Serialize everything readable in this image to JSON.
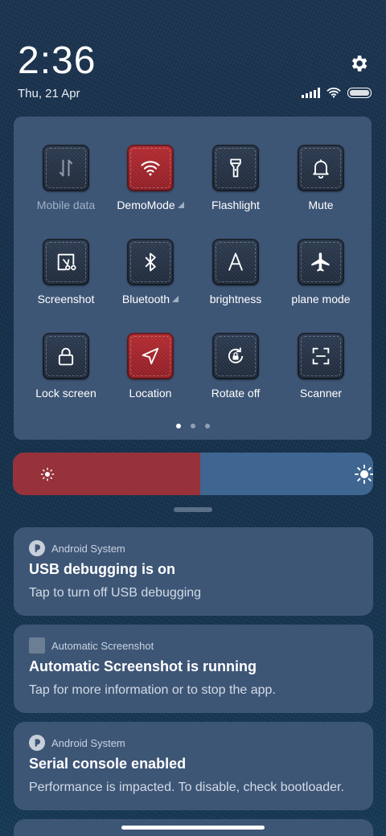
{
  "status": {
    "time": "2:36",
    "date": "Thu, 21 Apr",
    "icons": [
      "gear-icon",
      "signal-icon",
      "wifi-icon",
      "battery-icon"
    ]
  },
  "quick_settings": {
    "tiles": [
      {
        "label": "Mobile data",
        "icon": "mobile-data-icon",
        "active": false
      },
      {
        "label": "DemoMode",
        "icon": "wifi-icon",
        "active": true
      },
      {
        "label": "Flashlight",
        "icon": "flashlight-icon",
        "active": false
      },
      {
        "label": "Mute",
        "icon": "bell-icon",
        "active": false
      },
      {
        "label": "Screenshot",
        "icon": "screenshot-icon",
        "active": false
      },
      {
        "label": "Bluetooth",
        "icon": "bluetooth-icon",
        "active": false
      },
      {
        "label": "brightness",
        "icon": "brightness-auto-icon",
        "active": false
      },
      {
        "label": "plane mode",
        "icon": "airplane-icon",
        "active": false
      },
      {
        "label": "Lock screen",
        "icon": "lock-icon",
        "active": false
      },
      {
        "label": "Location",
        "icon": "location-icon",
        "active": true
      },
      {
        "label": "Rotate off",
        "icon": "rotate-lock-icon",
        "active": false
      },
      {
        "label": "Scanner",
        "icon": "scanner-icon",
        "active": false
      }
    ],
    "page": 1,
    "pages": 3
  },
  "brightness": {
    "level": 0.52
  },
  "notifications": [
    {
      "app": "Android System",
      "title": "USB debugging is on",
      "text": "Tap to turn off USB debugging"
    },
    {
      "app": "Automatic Screenshot",
      "title": "Automatic Screenshot is running",
      "text": "Tap for more information or to stop the app."
    },
    {
      "app": "Android System",
      "title": "Serial console enabled",
      "text": "Performance is impacted. To disable, check bootloader."
    }
  ],
  "colors": {
    "active_tile": "#b22a30",
    "panel": "#3e5676",
    "brightness_fill": "#97323a",
    "brightness_track": "#3f6591"
  }
}
